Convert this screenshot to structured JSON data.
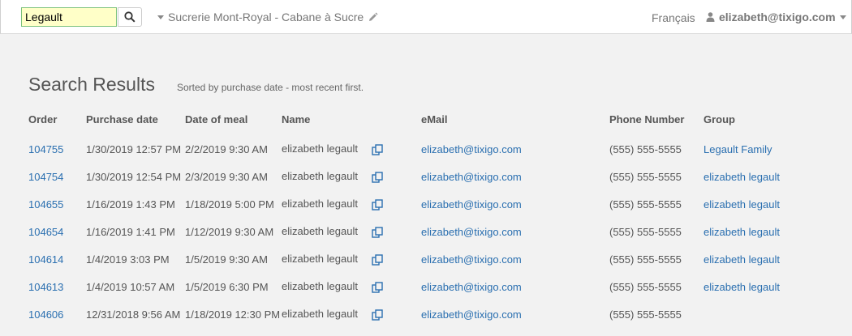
{
  "search": {
    "value": "Legault"
  },
  "header": {
    "venue": "Sucrerie Mont-Royal - Cabane à Sucre",
    "language": "Français",
    "account": "elizabeth@tixigo.com"
  },
  "page": {
    "title": "Search Results",
    "sort_note": "Sorted by purchase date - most recent first."
  },
  "columns": {
    "order": "Order",
    "purchase_date": "Purchase date",
    "meal_date": "Date of meal",
    "name": "Name",
    "email": "eMail",
    "phone": "Phone Number",
    "group": "Group"
  },
  "rows": [
    {
      "order": "104755",
      "purchase_date": "1/30/2019 12:57 PM",
      "meal_date": "2/2/2019 9:30 AM",
      "name": "elizabeth legault",
      "email": "elizabeth@tixigo.com",
      "phone": "(555) 555-5555",
      "group": "Legault Family"
    },
    {
      "order": "104754",
      "purchase_date": "1/30/2019 12:54 PM",
      "meal_date": "2/3/2019 9:30 AM",
      "name": "elizabeth legault",
      "email": "elizabeth@tixigo.com",
      "phone": "(555) 555-5555",
      "group": "elizabeth legault"
    },
    {
      "order": "104655",
      "purchase_date": "1/16/2019 1:43 PM",
      "meal_date": "1/18/2019 5:00 PM",
      "name": "elizabeth legault",
      "email": "elizabeth@tixigo.com",
      "phone": "(555) 555-5555",
      "group": "elizabeth legault"
    },
    {
      "order": "104654",
      "purchase_date": "1/16/2019 1:41 PM",
      "meal_date": "1/12/2019 9:30 AM",
      "name": "elizabeth legault",
      "email": "elizabeth@tixigo.com",
      "phone": "(555) 555-5555",
      "group": "elizabeth legault"
    },
    {
      "order": "104614",
      "purchase_date": "1/4/2019 3:03 PM",
      "meal_date": "1/5/2019 9:30 AM",
      "name": "elizabeth legault",
      "email": "elizabeth@tixigo.com",
      "phone": "(555) 555-5555",
      "group": "elizabeth legault"
    },
    {
      "order": "104613",
      "purchase_date": "1/4/2019 10:57 AM",
      "meal_date": "1/5/2019 6:30 PM",
      "name": "elizabeth legault",
      "email": "elizabeth@tixigo.com",
      "phone": "(555) 555-5555",
      "group": "elizabeth legault"
    },
    {
      "order": "104606",
      "purchase_date": "12/31/2018 9:56 AM",
      "meal_date": "1/18/2019 12:30 PM",
      "name": "elizabeth legault",
      "email": "elizabeth@tixigo.com",
      "phone": "(555) 555-5555",
      "group": ""
    }
  ],
  "colors": {
    "link": "#2a6fb0",
    "search_bg": "#ffffc8",
    "search_border": "#7cc27c"
  },
  "icons": {
    "search": "search-icon",
    "copy": "copy-icon",
    "edit": "pencil-icon",
    "user": "user-icon",
    "caret": "caret-down-icon"
  }
}
